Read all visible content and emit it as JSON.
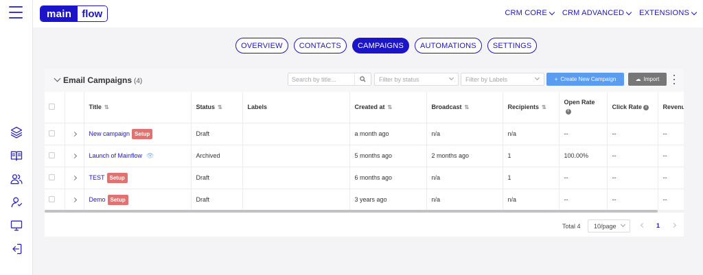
{
  "header": {
    "logo_part1": "main",
    "logo_part2": "flow",
    "nav": [
      "CRM CORE",
      "CRM ADVANCED",
      "EXTENSIONS"
    ]
  },
  "sidebar": {
    "items": [
      {
        "icon": "layers-icon"
      },
      {
        "icon": "book-icon"
      },
      {
        "icon": "users-icon"
      },
      {
        "icon": "user-icon"
      },
      {
        "icon": "monitor-icon"
      },
      {
        "icon": "logout-icon"
      }
    ]
  },
  "tabs": [
    {
      "label": "OVERVIEW",
      "active": false
    },
    {
      "label": "CONTACTS",
      "active": false
    },
    {
      "label": "CAMPAIGNS",
      "active": true
    },
    {
      "label": "AUTOMATIONS",
      "active": false
    },
    {
      "label": "SETTINGS",
      "active": false
    }
  ],
  "card": {
    "title": "Email Campaigns",
    "count": "(4)",
    "search_placeholder": "Search by title...",
    "filter_status_placeholder": "Filter by status",
    "filter_labels_placeholder": "Filter by Labels",
    "create_label": "Create New Campaign",
    "import_label": "Import"
  },
  "table": {
    "columns": [
      "Title",
      "Status",
      "Labels",
      "Created at",
      "Broadcast",
      "Recipients",
      "Open Rate",
      "Click Rate",
      "Revenue"
    ],
    "rows": [
      {
        "title": "New campaign",
        "badge": "Setup",
        "eye": false,
        "status": "Draft",
        "labels": "",
        "created": "a month ago",
        "broadcast": "n/a",
        "recipients": "n/a",
        "open_rate": "--",
        "click_rate": "--",
        "revenue": "--"
      },
      {
        "title": "Launch of Mainflow",
        "badge": "",
        "eye": true,
        "status": "Archived",
        "labels": "",
        "created": "5 months ago",
        "broadcast": "2 months ago",
        "recipients": "1",
        "open_rate": "100.00%",
        "click_rate": "--",
        "revenue": "--"
      },
      {
        "title": "TEST",
        "badge": "Setup",
        "eye": false,
        "status": "Draft",
        "labels": "",
        "created": "6 months ago",
        "broadcast": "n/a",
        "recipients": "1",
        "open_rate": "--",
        "click_rate": "--",
        "revenue": "--"
      },
      {
        "title": "Demo",
        "badge": "Setup",
        "eye": false,
        "status": "Draft",
        "labels": "",
        "created": "3 years ago",
        "broadcast": "n/a",
        "recipients": "n/a",
        "open_rate": "--",
        "click_rate": "--",
        "revenue": "--"
      }
    ]
  },
  "pagination": {
    "total": "Total 4",
    "page_size": "10/page",
    "current_page": "1"
  },
  "colors": {
    "brand": "#1b14c9",
    "create_button": "#5b9cf0",
    "import_button": "#777777",
    "setup_badge": "#e07272"
  }
}
